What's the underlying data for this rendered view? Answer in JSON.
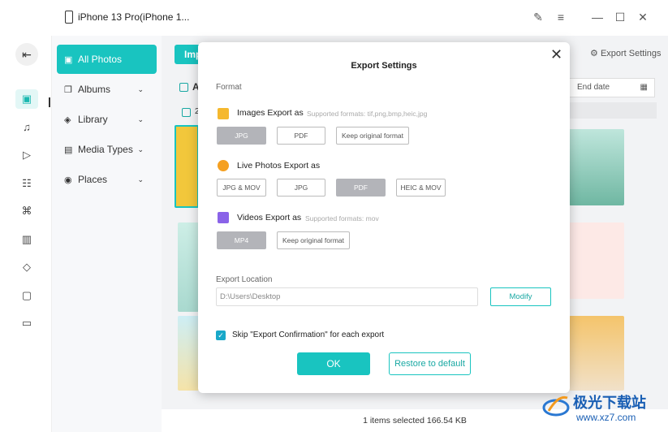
{
  "titlebar": {
    "device_name": "iPhone 13 Pro(iPhone 1...",
    "icons": [
      "edit-icon",
      "menu-icon",
      "minimize-icon",
      "maximize-icon",
      "close-icon"
    ]
  },
  "rail": {
    "icons": [
      "back-icon",
      "photos-icon",
      "music-icon",
      "video-icon",
      "contacts-icon",
      "apps-icon",
      "books-icon",
      "tag-icon",
      "backup-icon",
      "folder-icon"
    ]
  },
  "nav": {
    "items": [
      {
        "label": "All Photos",
        "icon": "photo-icon"
      },
      {
        "label": "Albums",
        "icon": "album-icon"
      },
      {
        "label": "Library",
        "icon": "layers-icon"
      },
      {
        "label": "Media Types",
        "icon": "media-icon"
      },
      {
        "label": "Places",
        "icon": "pin-icon"
      }
    ]
  },
  "main": {
    "import_button": "Imp",
    "heading_partial": "A",
    "row_partial": "2",
    "export_settings_link": "Export Settings",
    "end_date_placeholder": "End date",
    "status": "1 items selected 166.54 KB"
  },
  "modal": {
    "title": "Export Settings",
    "format_label": "Format",
    "images": {
      "label": "Images Export as",
      "hint": "Supported formats: tif,png,bmp,heic,jpg",
      "options": [
        "JPG",
        "PDF",
        "Keep original format"
      ],
      "selected": "JPG"
    },
    "live": {
      "label": "Live Photos Export as",
      "options": [
        "JPG & MOV",
        "JPG",
        "PDF",
        "HEIC & MOV"
      ],
      "selected": "PDF"
    },
    "videos": {
      "label": "Videos Export as",
      "hint": "Supported formats: mov",
      "options": [
        "MP4",
        "Keep original format"
      ],
      "selected": "MP4"
    },
    "location_label": "Export Location",
    "location_value": "D:\\Users\\Desktop",
    "modify_button": "Modify",
    "skip_label": "Skip \"Export Confirmation\" for each export",
    "skip_checked": true,
    "ok_button": "OK",
    "restore_button": "Restore to default"
  },
  "watermark": {
    "text_main": "极光下载站",
    "text_url": "www.xz7.com"
  },
  "colors": {
    "accent": "#19c4c0",
    "selected_option": "#b3b4b9"
  }
}
